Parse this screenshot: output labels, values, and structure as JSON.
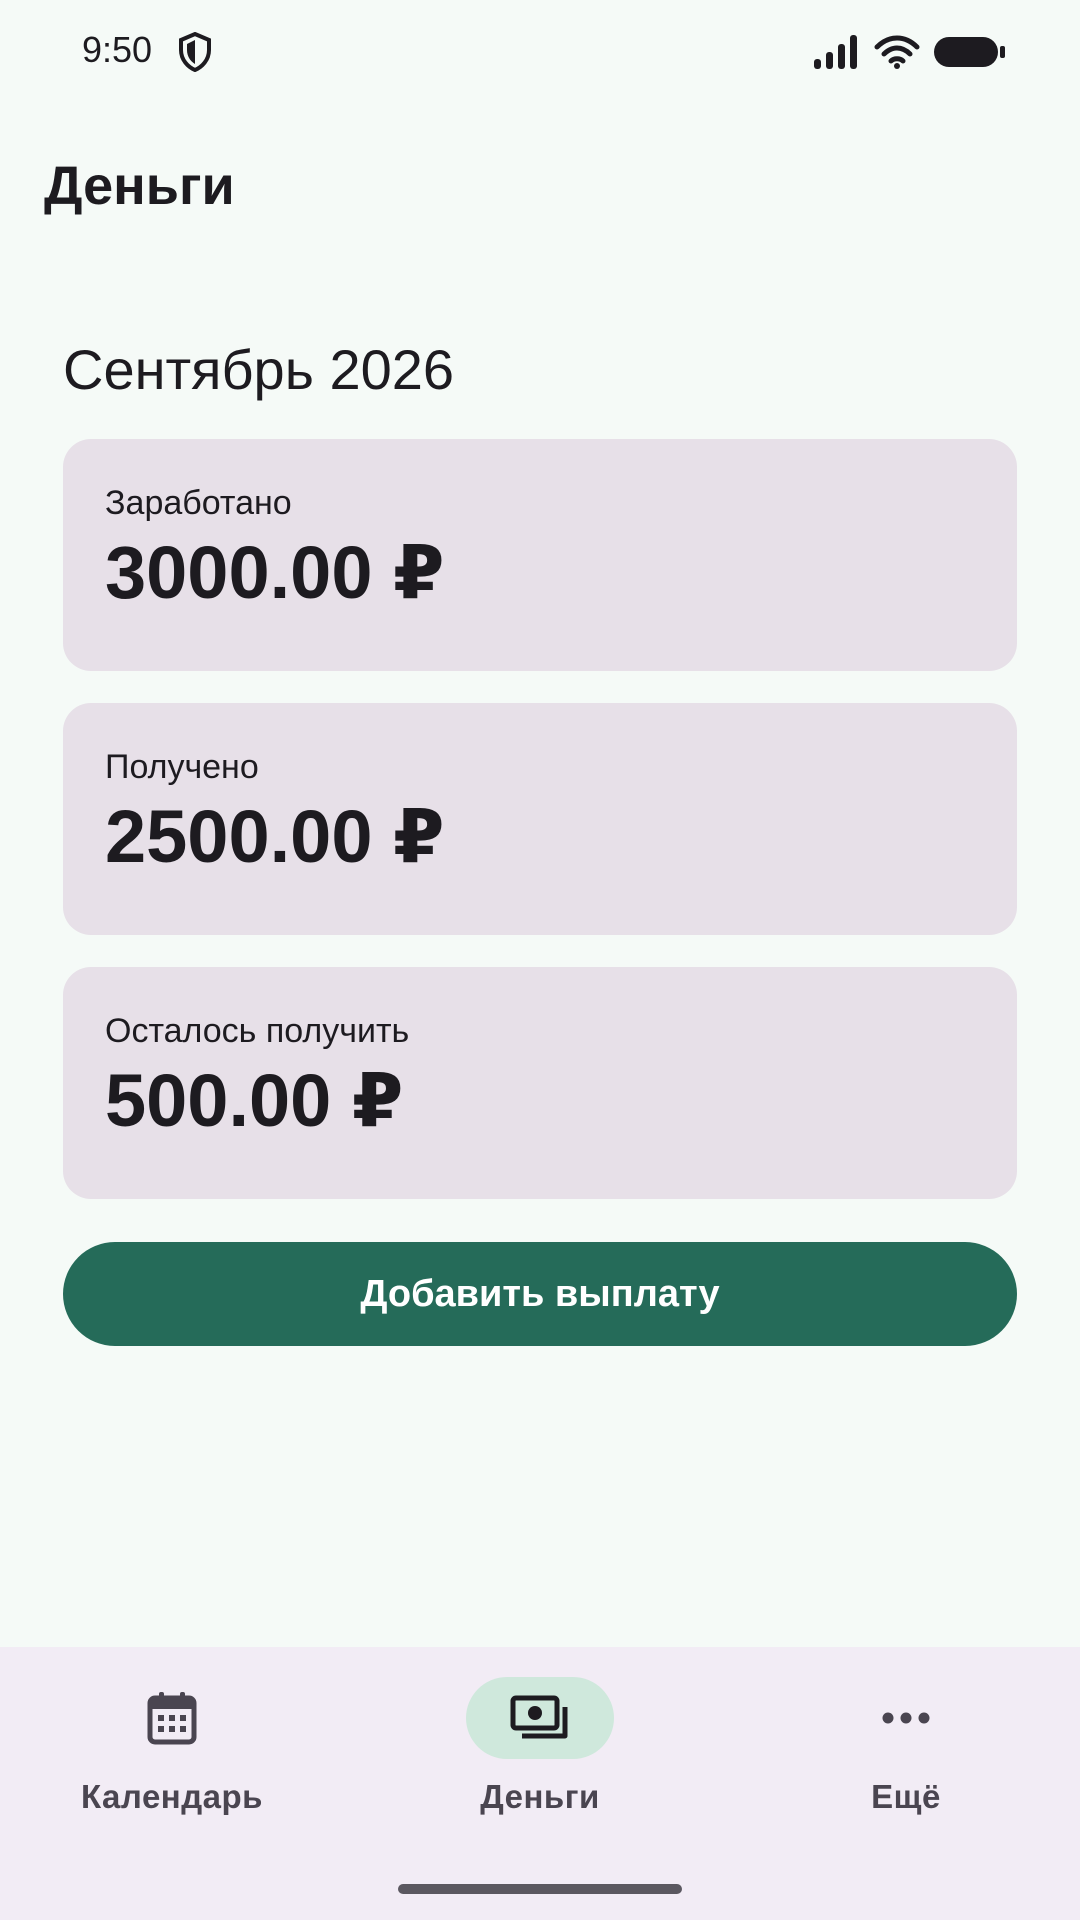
{
  "status_bar": {
    "time": "9:50"
  },
  "app_bar": {
    "title": "Деньги"
  },
  "month": {
    "title": "Сентябрь 2026"
  },
  "cards": [
    {
      "label": "Заработано",
      "value": "3000.00 ₽"
    },
    {
      "label": "Получено",
      "value": "2500.00 ₽"
    },
    {
      "label": "Осталось получить",
      "value": "500.00 ₽"
    }
  ],
  "actions": {
    "add_payment_label": "Добавить выплату"
  },
  "bottom_nav": {
    "items": [
      {
        "label": "Календарь",
        "icon": "calendar-icon",
        "active": false
      },
      {
        "label": "Деньги",
        "icon": "money-icon",
        "active": true
      },
      {
        "label": "Ещё",
        "icon": "more-icon",
        "active": false
      }
    ]
  },
  "colors": {
    "background": "#f5faf7",
    "card": "#e7e0e8",
    "primary": "#256b59",
    "nav_background": "#f2ecf5",
    "nav_active_indicator": "#cfe8dc"
  }
}
